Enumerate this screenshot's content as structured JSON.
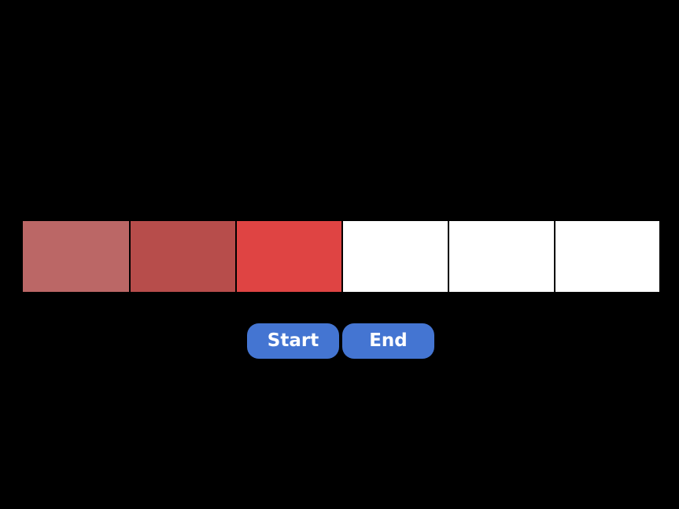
{
  "swatches": [
    {
      "id": "swatch-1",
      "color": "#bb6766"
    },
    {
      "id": "swatch-2",
      "color": "#b74d4b"
    },
    {
      "id": "swatch-3",
      "color": "#df4443"
    },
    {
      "id": "swatch-4",
      "color": "#ffffff"
    },
    {
      "id": "swatch-5",
      "color": "#ffffff"
    },
    {
      "id": "swatch-6",
      "color": "#ffffff"
    }
  ],
  "buttons": {
    "start_label": "Start",
    "end_label": "End",
    "color": "#4475d2"
  },
  "background_color": "#000000"
}
